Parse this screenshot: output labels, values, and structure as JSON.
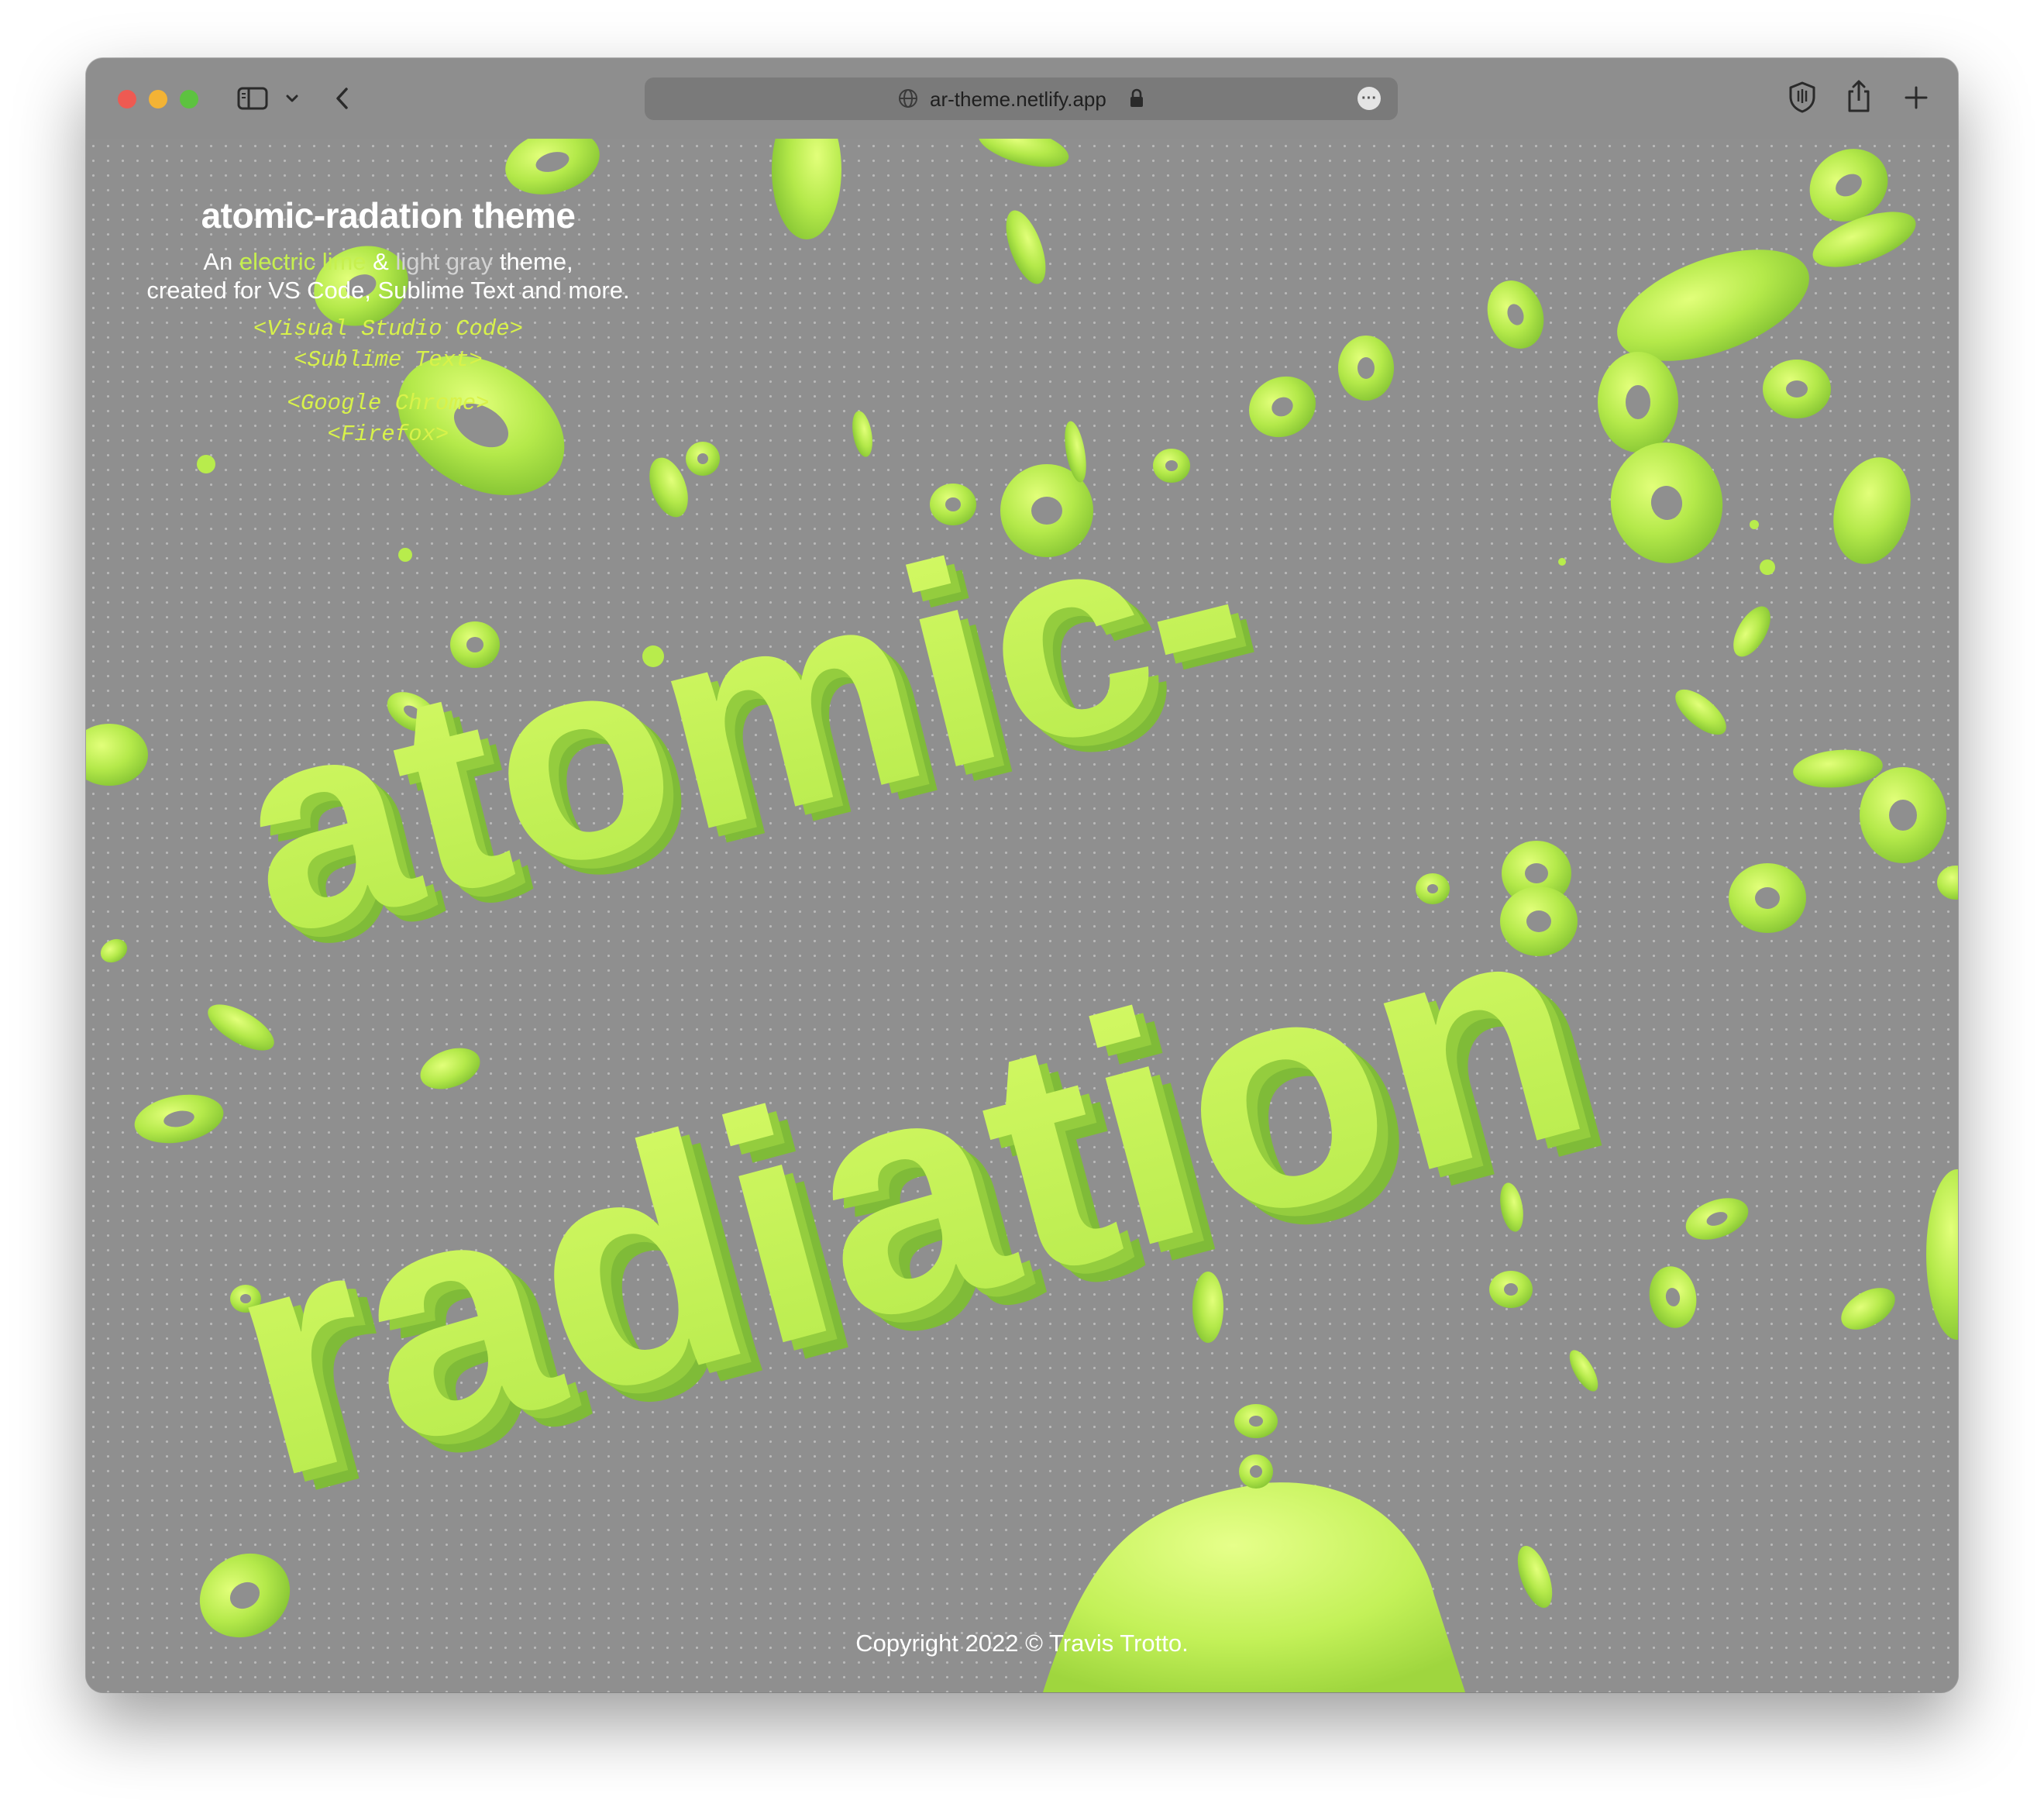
{
  "browser": {
    "url": "ar-theme.netlify.app",
    "icons": [
      "close-dot",
      "minimize-dot",
      "zoom-dot",
      "sidebar-icon",
      "chevron-down-icon",
      "back-icon",
      "globe-icon",
      "lock-icon",
      "more-icon",
      "shield-icon",
      "share-icon",
      "new-tab-icon"
    ]
  },
  "page": {
    "title": "atomic-radation theme",
    "subtitle": {
      "pre": "An ",
      "lime": "electric lime",
      "amp": " & ",
      "gray": "light gray",
      "post": " theme,",
      "line2": "created for VS Code, Sublime Text and more."
    },
    "links": {
      "vscode": "<Visual Studio Code>",
      "sublime": "<Sublime Text>",
      "chrome": "<Google Chrome>",
      "firefox": "<Firefox>"
    },
    "hero": {
      "line1": "atomic-",
      "line2": "radiation"
    },
    "footer": "Copyright 2022 © Travis Trotto."
  },
  "colors": {
    "accent_lime": "#c6f04e",
    "background_gray": "#8f8f8f"
  }
}
